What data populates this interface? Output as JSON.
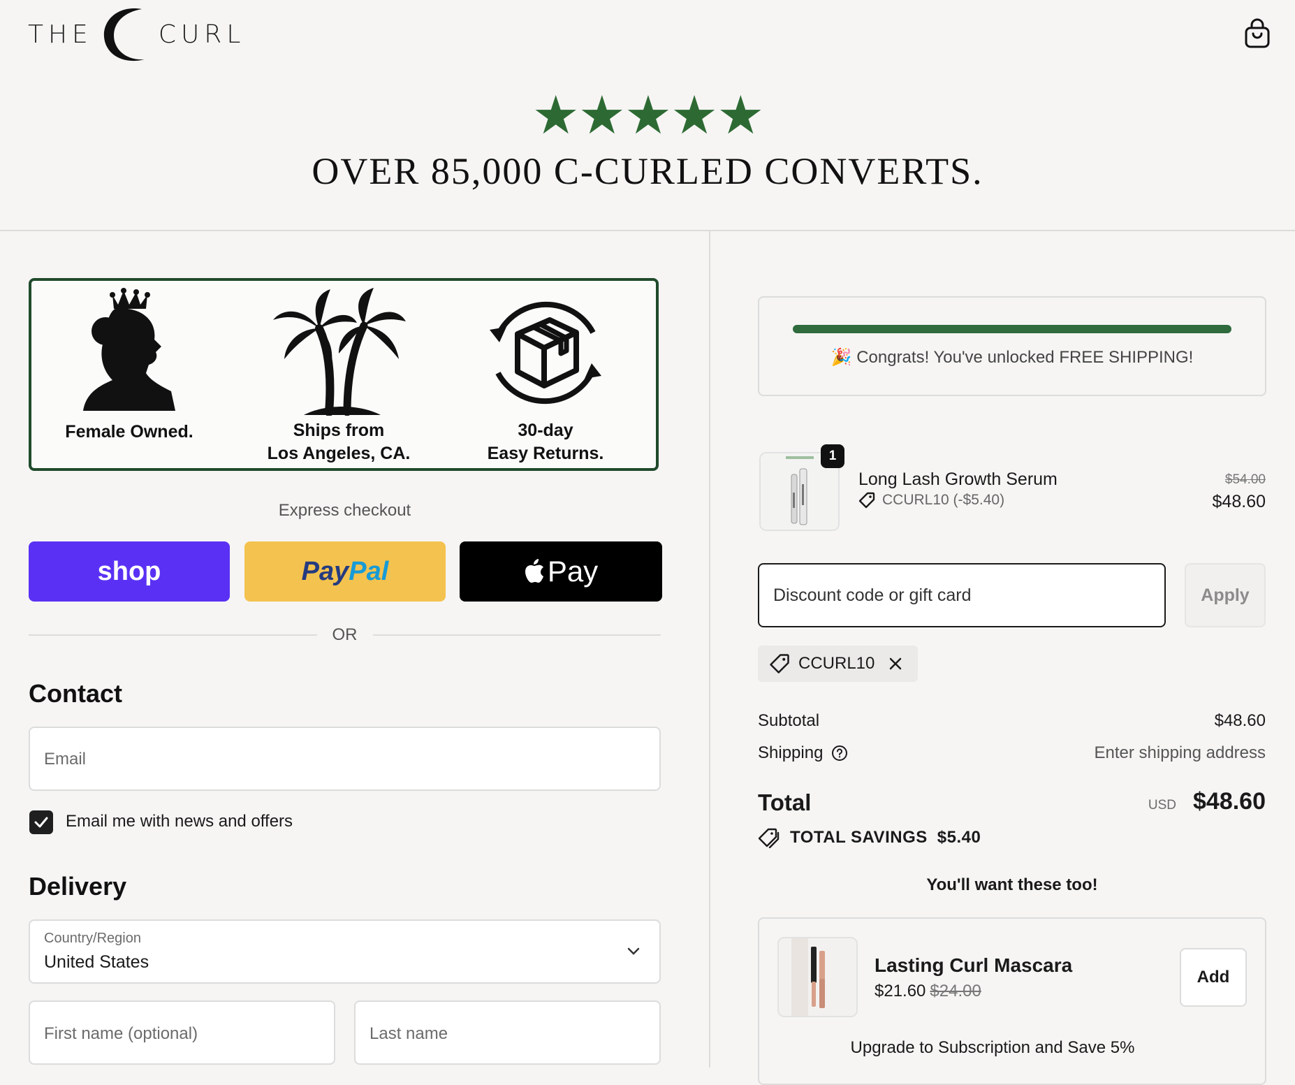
{
  "header": {
    "logo_left": "THE",
    "logo_right": "CURL",
    "stars": "★★★★★",
    "headline": "OVER 85,000 C-CURLED CONVERTS."
  },
  "trust": {
    "items": [
      {
        "label": "Female Owned.",
        "icon": "queen-silhouette-icon"
      },
      {
        "label": "Ships from\nLos Angeles, CA.",
        "icon": "palm-trees-icon"
      },
      {
        "label": "30-day\nEasy Returns.",
        "icon": "box-return-icon"
      }
    ]
  },
  "express": {
    "label": "Express checkout",
    "shop": "shop",
    "paypal_a": "Pay",
    "paypal_b": "Pal",
    "applepay": "Pay",
    "or": "OR"
  },
  "contact": {
    "heading": "Contact",
    "email_placeholder": "Email",
    "newsletter_label": "Email me with news and offers",
    "newsletter_checked": true
  },
  "delivery": {
    "heading": "Delivery",
    "country_label": "Country/Region",
    "country_value": "United States",
    "first_name_placeholder": "First name (optional)",
    "last_name_placeholder": "Last name"
  },
  "shipping_banner": {
    "progress_percent": 100,
    "message": "🎉 Congrats! You've unlocked FREE SHIPPING!"
  },
  "cart": {
    "item": {
      "quantity": "1",
      "name": "Long Lash Growth Serum",
      "discount": "CCURL10 (-$5.40)",
      "original_price": "$54.00",
      "price": "$48.60"
    },
    "discount_placeholder": "Discount code or gift card",
    "apply_label": "Apply",
    "applied_code": "CCURL10"
  },
  "summary": {
    "subtotal_label": "Subtotal",
    "subtotal_value": "$48.60",
    "shipping_label": "Shipping",
    "shipping_value": "Enter shipping address",
    "total_label": "Total",
    "currency": "USD",
    "total_value": "$48.60",
    "savings_label": "TOTAL SAVINGS",
    "savings_value": "$5.40"
  },
  "upsell": {
    "title": "You'll want these too!",
    "name": "Lasting Curl Mascara",
    "price": "$21.60",
    "old_price": "$24.00",
    "add_label": "Add",
    "upgrade": "Upgrade to Subscription and Save 5%"
  },
  "colors": {
    "brand_green": "#2d6a33",
    "shop_purple": "#5a31f4",
    "paypal_yellow": "#f4c24e"
  }
}
